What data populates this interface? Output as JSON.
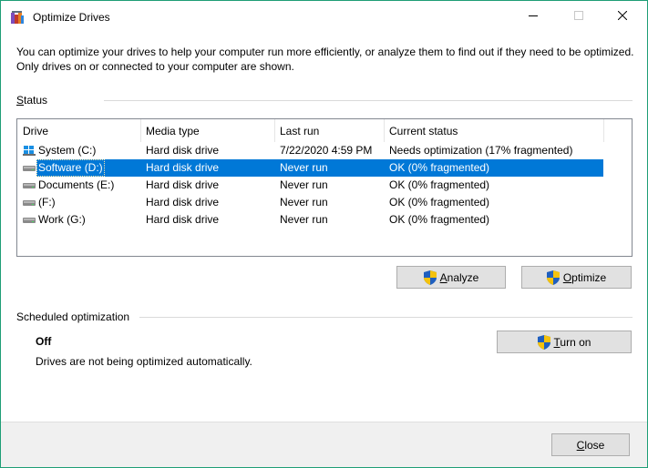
{
  "window": {
    "title": "Optimize Drives",
    "border_color": "#1e9e76"
  },
  "intro": "You can optimize your drives to help your computer run more efficiently, or analyze them to find out if they need to be optimized. Only drives on or connected to your computer are shown.",
  "status_section": {
    "label_first": "S",
    "label_rest": "tatus",
    "columns": [
      "Drive",
      "Media type",
      "Last run",
      "Current status"
    ],
    "drives": [
      {
        "name": "System (C:)",
        "media_type": "Hard disk drive",
        "last_run": "7/22/2020 4:59 PM",
        "status": "Needs optimization (17% fragmented)",
        "icon": "system-drive-icon",
        "selected": false
      },
      {
        "name": "Software (D:)",
        "media_type": "Hard disk drive",
        "last_run": "Never run",
        "status": "OK (0% fragmented)",
        "icon": "hard-drive-icon",
        "selected": true
      },
      {
        "name": "Documents (E:)",
        "media_type": "Hard disk drive",
        "last_run": "Never run",
        "status": "OK (0% fragmented)",
        "icon": "hard-drive-icon",
        "selected": false
      },
      {
        "name": "(F:)",
        "media_type": "Hard disk drive",
        "last_run": "Never run",
        "status": "OK (0% fragmented)",
        "icon": "hard-drive-icon",
        "selected": false
      },
      {
        "name": "Work (G:)",
        "media_type": "Hard disk drive",
        "last_run": "Never run",
        "status": "OK (0% fragmented)",
        "icon": "hard-drive-icon",
        "selected": false
      }
    ],
    "selection_color": "#0078d7"
  },
  "actions": {
    "analyze_first": "A",
    "analyze_rest": "nalyze",
    "optimize_first": "O",
    "optimize_rest": "ptimize"
  },
  "scheduled": {
    "label": "Scheduled optimization",
    "state": "Off",
    "description": "Drives are not being optimized automatically.",
    "turn_on_first": "T",
    "turn_on_rest": "urn on"
  },
  "footer": {
    "close_first": "C",
    "close_rest": "lose"
  }
}
